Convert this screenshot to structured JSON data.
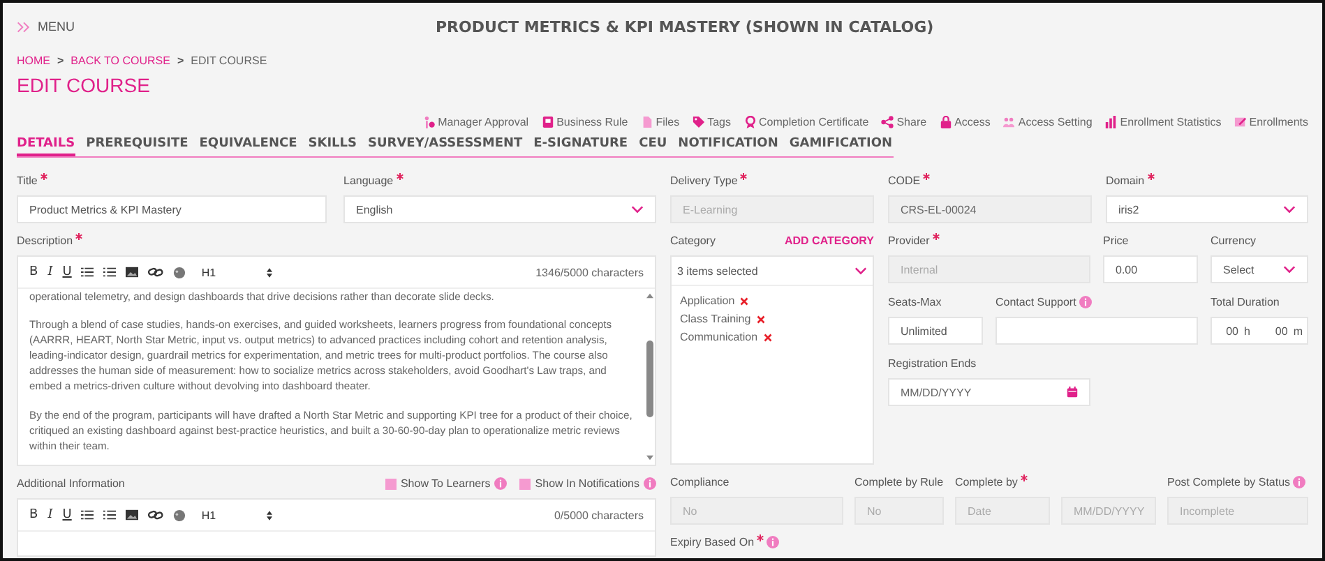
{
  "header": {
    "menu_label": "MENU",
    "course_title": "PRODUCT METRICS & KPI MASTERY (SHOWN IN CATALOG)"
  },
  "breadcrumbs": {
    "separator": ">",
    "items": [
      {
        "label": "HOME",
        "link": true
      },
      {
        "label": "BACK TO COURSE",
        "link": true
      },
      {
        "label": "EDIT COURSE",
        "link": false
      }
    ]
  },
  "page_title": "EDIT COURSE",
  "actions": [
    "Manager Approval",
    "Business Rule",
    "Files",
    "Tags",
    "Completion Certificate",
    "Share",
    "Access",
    "Access Setting",
    "Enrollment Statistics",
    "Enrollments"
  ],
  "tabs": [
    {
      "label": "DETAILS",
      "selected": true
    },
    {
      "label": "PREREQUISITE",
      "selected": false
    },
    {
      "label": "EQUIVALENCE",
      "selected": false
    },
    {
      "label": "SKILLS",
      "selected": false
    },
    {
      "label": "SURVEY/ASSESSMENT",
      "selected": false
    },
    {
      "label": "E-SIGNATURE",
      "selected": false
    },
    {
      "label": "CEU",
      "selected": false
    },
    {
      "label": "NOTIFICATION",
      "selected": false
    },
    {
      "label": "GAMIFICATION",
      "selected": false
    }
  ],
  "title_field": {
    "label": "Title",
    "required": true,
    "kind": "text",
    "value": "Product Metrics & KPI Mastery",
    "disabled": false
  },
  "language_field": {
    "label": "Language",
    "required": true,
    "kind": "select",
    "value": "English",
    "disabled": false
  },
  "description": {
    "label": "Description",
    "required": true,
    "toolbar": {
      "format_buttons": [
        "B",
        "I",
        "U"
      ],
      "heading": "H1"
    },
    "counter": "1346/5000 characters",
    "paragraphs": [
      "operational telemetry, and design dashboards that drive decisions rather than decorate slide decks.",
      "Through a blend of case studies, hands-on exercises, and guided worksheets, learners progress from foundational concepts (AARRR, HEART, North Star Metric, input vs. output metrics) to advanced practices including cohort and retention analysis, leading-indicator design, guardrail metrics for experimentation, and metric trees for multi-product portfolios. The course also addresses the human side of measurement: how to socialize metrics across stakeholders, avoid Goodhart's Law traps, and embed a metrics-driven culture without devolving into dashboard theater.",
      "By the end of the program, participants will have drafted a North Star Metric and supporting KPI tree for a product of their choice, critiqued an existing dashboard against best-practice heuristics, and built a 30-60-90-day plan to operationalize metric reviews within their team."
    ]
  },
  "additional_information": {
    "label": "Additional Information",
    "checkboxes": [
      {
        "label": "Show To Learners",
        "checked": false
      },
      {
        "label": "Show In Notifications",
        "checked": false
      }
    ],
    "toolbar": {
      "format_buttons": [
        "B",
        "I",
        "U"
      ],
      "heading": "H1"
    },
    "counter": "0/5000 characters"
  },
  "top_fields": [
    {
      "label": "Delivery Type",
      "required": true,
      "kind": "text",
      "placeholder": "E-Learning",
      "disabled": true
    },
    {
      "label": "CODE",
      "required": true,
      "kind": "text",
      "value": "CRS-EL-00024",
      "disabled": true
    },
    {
      "label": "Domain",
      "required": true,
      "kind": "select",
      "value": "iris2",
      "disabled": false
    }
  ],
  "category": {
    "label": "Category",
    "action": "ADD CATEGORY",
    "summary": "3 items selected",
    "items": [
      "Application",
      "Class Training",
      "Communication"
    ]
  },
  "detail_fields": [
    {
      "label": "Provider",
      "required": true,
      "kind": "text",
      "placeholder": "Internal",
      "disabled": true
    },
    {
      "label": "Price",
      "required": false,
      "kind": "text",
      "value": "0.00",
      "disabled": false
    },
    {
      "label": "Currency",
      "required": false,
      "kind": "select",
      "value": "Select",
      "disabled": false
    },
    {
      "label": "Seats-Max",
      "required": false,
      "kind": "text",
      "value": "Unlimited",
      "disabled": false
    },
    {
      "label": "Contact Support",
      "required": false,
      "info": true,
      "kind": "text",
      "disabled": false
    },
    {
      "label": "Total Duration",
      "required": false,
      "kind": "duration",
      "hours": "00",
      "hours_unit": "h",
      "minutes": "00",
      "minutes_unit": "m",
      "disabled": false
    },
    {
      "label": "Registration Ends",
      "required": false,
      "kind": "date",
      "placeholder": "MM/DD/YYYY",
      "disabled": false
    }
  ],
  "compliance_fields": [
    {
      "label": "Compliance",
      "required": false,
      "kind": "text",
      "placeholder": "No",
      "disabled": true
    },
    {
      "label": "Complete by Rule",
      "required": false,
      "kind": "text",
      "placeholder": "No",
      "disabled": true
    },
    {
      "label": "Complete by",
      "required": true,
      "kind": "text",
      "placeholder": "Date",
      "disabled": true
    },
    {
      "kind": "date",
      "placeholder": "MM/DD/YYYY",
      "disabled": true
    },
    {
      "label": "Post Complete by Status",
      "required": false,
      "info": true,
      "kind": "text",
      "placeholder": "Incomplete",
      "disabled": true
    }
  ],
  "expiry": {
    "label": "Expiry Based On",
    "required": true,
    "info": true
  }
}
